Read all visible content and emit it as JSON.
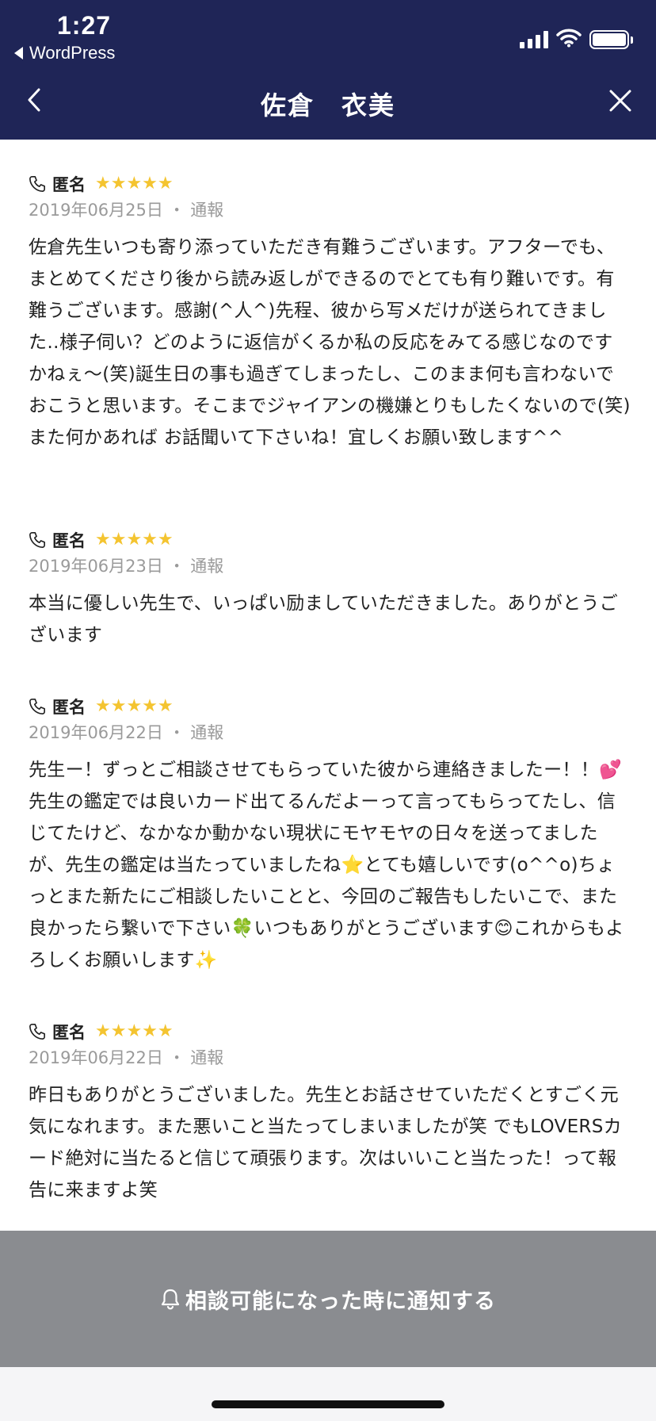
{
  "status_bar": {
    "time": "1:27",
    "back_app": "WordPress",
    "icons": [
      "signal-icon",
      "wifi-icon",
      "battery-icon"
    ]
  },
  "nav": {
    "title": "佐倉　衣美",
    "back_icon": "chevron-left-icon",
    "close_icon": "close-icon"
  },
  "reviews": [
    {
      "name": "匿名",
      "stars": "★★★★★",
      "rating": 5,
      "date": "2019年06月25日",
      "report": "通報",
      "body": "佐倉先生いつも寄り添っていただき有難うございます。アフターでも、まとめてくださり後から読み返しができるのでとても有り難いです。有難うございます。感謝(^人^)先程、彼から写メだけが送られてきました‥様子伺い？どのように返信がくるか私の反応をみてる感じなのですかねぇ〜(笑)誕生日の事も過ぎてしまったし、このまま何も言わないでおこうと思います。そこまでジャイアンの機嫌とりもしたくないので(笑)また何かあれば お話聞いて下さいね！宜しくお願い致します^^"
    },
    {
      "name": "匿名",
      "stars": "★★★★★",
      "rating": 5,
      "date": "2019年06月23日",
      "report": "通報",
      "body": "本当に優しい先生で、いっぱい励ましていただきました。ありがとうございます"
    },
    {
      "name": "匿名",
      "stars": "★★★★★",
      "rating": 5,
      "date": "2019年06月22日",
      "report": "通報",
      "body": "先生ー！ずっとご相談させてもらっていた彼から連絡きましたー！！💕先生の鑑定では良いカード出てるんだよーって言ってもらってたし、信じてたけど、なかなか動かない現状にモヤモヤの日々を送ってましたが、先生の鑑定は当たっていましたね⭐️とても嬉しいです(o^^o)ちょっとまた新たにご相談したいことと、今回のご報告もしたいこで、また良かったら繋いで下さい🍀いつもありがとうございます😊これからもよろしくお願いします✨"
    },
    {
      "name": "匿名",
      "stars": "★★★★★",
      "rating": 5,
      "date": "2019年06月22日",
      "report": "通報",
      "body": "昨日もありがとうございました。先生とお話させていただくとすごく元気になれます。また悪いこと当たってしまいましたが笑 でもLOVERSカード絶対に当たると信じて頑張ります。次はいいこと当たった！って報告に来ますよ笑"
    }
  ],
  "notify_button": {
    "label": "相談可能になった時に通知する",
    "icon": "bell-icon"
  },
  "colors": {
    "header_bg": "#1f2557",
    "star": "#f4c430",
    "meta_text": "#9a9a9a",
    "notify_bg": "#8a8c90"
  }
}
